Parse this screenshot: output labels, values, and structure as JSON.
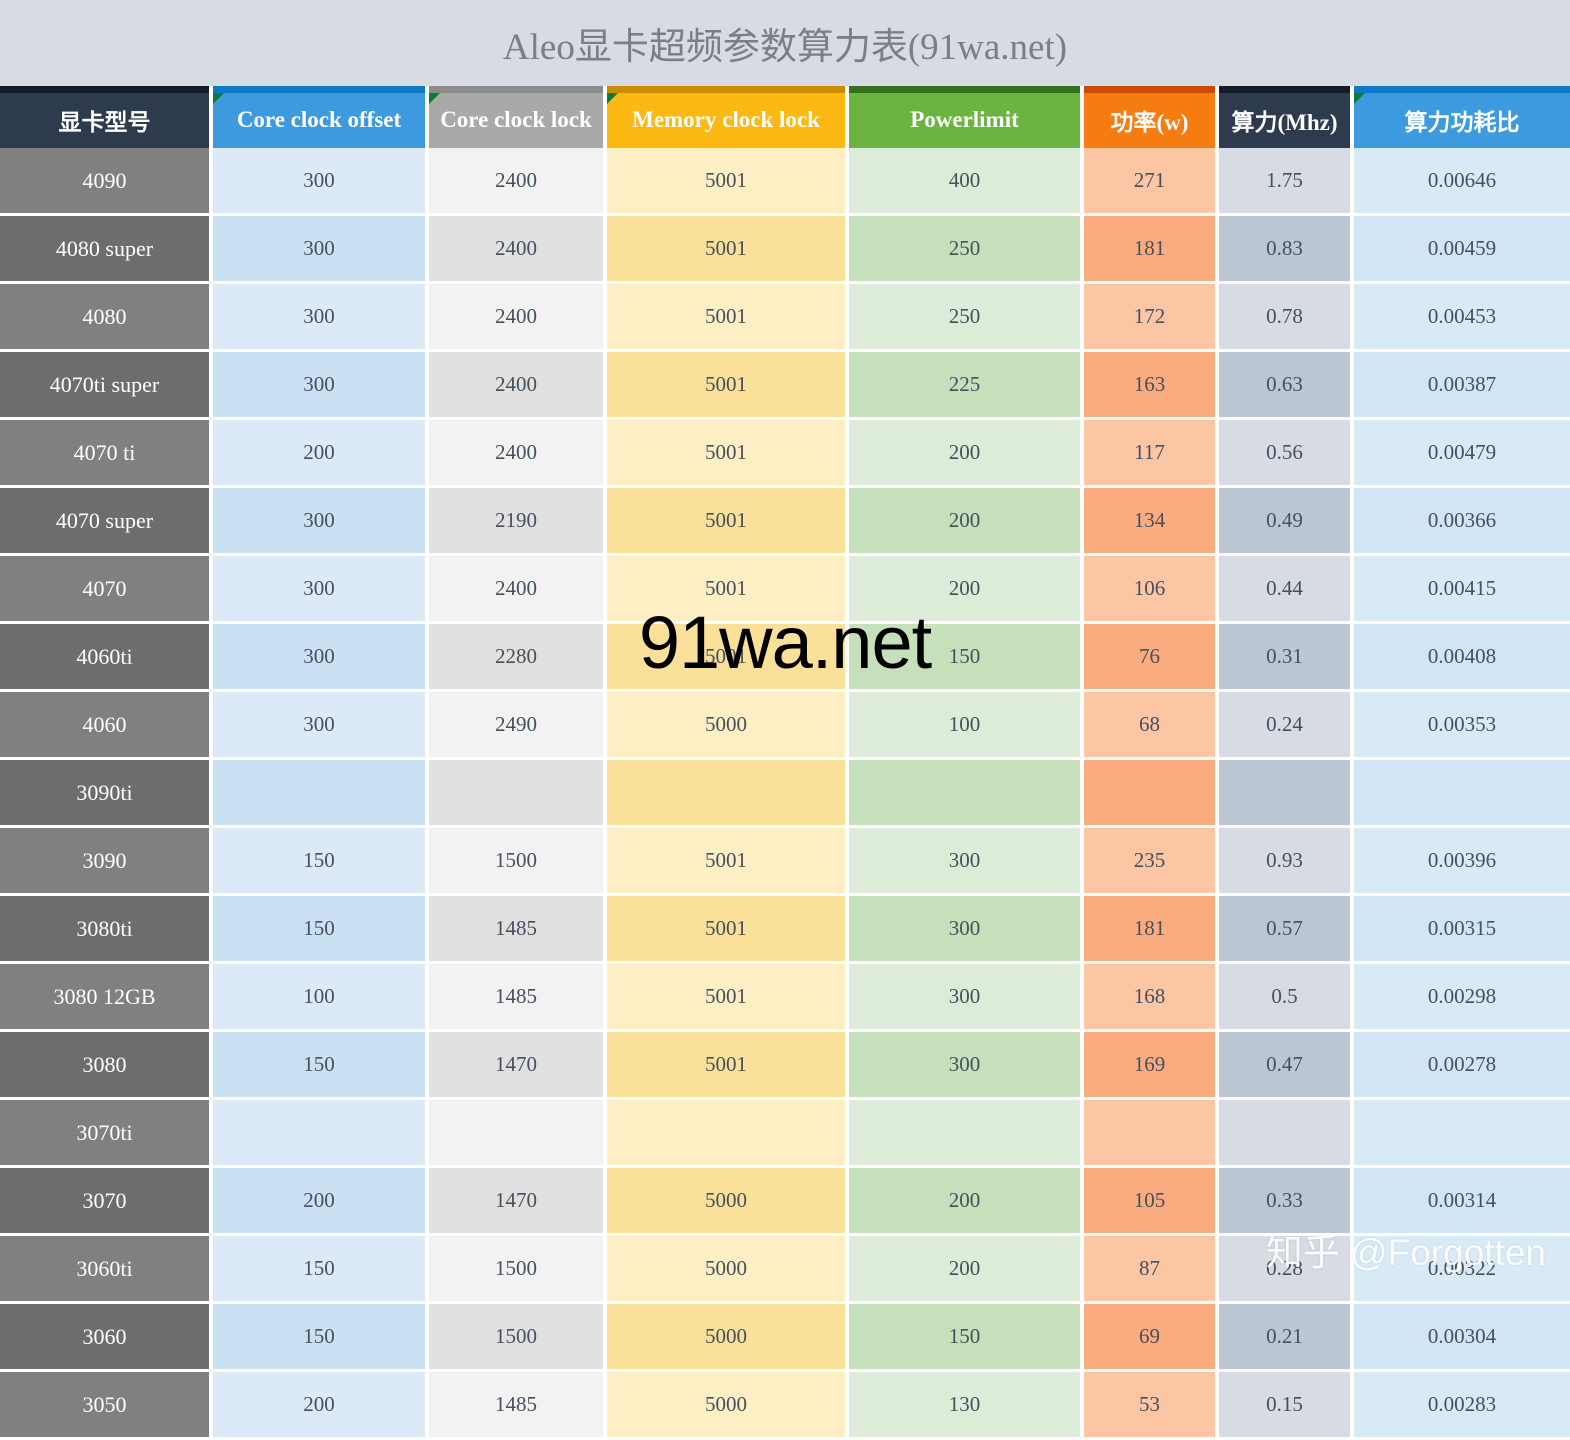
{
  "title": "Aleo显卡超频参数算力表(91wa.net)",
  "columns": [
    {
      "label": "显卡型号",
      "key": "model",
      "style": "h-dark",
      "triangle": false
    },
    {
      "label": "Core clock offset",
      "key": "coreoff",
      "style": "h-blue",
      "triangle": true
    },
    {
      "label": "Core clock lock",
      "key": "corelock",
      "style": "h-gray",
      "triangle": true
    },
    {
      "label": "Memory clock lock",
      "key": "memlock",
      "style": "h-amber",
      "triangle": true
    },
    {
      "label": "Powerlimit",
      "key": "power",
      "style": "h-green",
      "triangle": false
    },
    {
      "label": "功率(w)",
      "key": "watt",
      "style": "h-orange",
      "triangle": false
    },
    {
      "label": "算力(Mhz)",
      "key": "hash",
      "style": "h-dark",
      "triangle": false
    },
    {
      "label": "算力功耗比",
      "key": "ratio",
      "style": "h-blue",
      "triangle": true
    }
  ],
  "rows": [
    {
      "model": "4090",
      "coreoff": "300",
      "corelock": "2400",
      "memlock": "5001",
      "power": "400",
      "watt": "271",
      "hash": "1.75",
      "ratio": "0.00646"
    },
    {
      "model": "4080 super",
      "coreoff": "300",
      "corelock": "2400",
      "memlock": "5001",
      "power": "250",
      "watt": "181",
      "hash": "0.83",
      "ratio": "0.00459"
    },
    {
      "model": "4080",
      "coreoff": "300",
      "corelock": "2400",
      "memlock": "5001",
      "power": "250",
      "watt": "172",
      "hash": "0.78",
      "ratio": "0.00453"
    },
    {
      "model": "4070ti super",
      "coreoff": "300",
      "corelock": "2400",
      "memlock": "5001",
      "power": "225",
      "watt": "163",
      "hash": "0.63",
      "ratio": "0.00387"
    },
    {
      "model": "4070 ti",
      "coreoff": "200",
      "corelock": "2400",
      "memlock": "5001",
      "power": "200",
      "watt": "117",
      "hash": "0.56",
      "ratio": "0.00479"
    },
    {
      "model": "4070 super",
      "coreoff": "300",
      "corelock": "2190",
      "memlock": "5001",
      "power": "200",
      "watt": "134",
      "hash": "0.49",
      "ratio": "0.00366"
    },
    {
      "model": "4070",
      "coreoff": "300",
      "corelock": "2400",
      "memlock": "5001",
      "power": "200",
      "watt": "106",
      "hash": "0.44",
      "ratio": "0.00415"
    },
    {
      "model": "4060ti",
      "coreoff": "300",
      "corelock": "2280",
      "memlock": "5001",
      "power": "150",
      "watt": "76",
      "hash": "0.31",
      "ratio": "0.00408"
    },
    {
      "model": "4060",
      "coreoff": "300",
      "corelock": "2490",
      "memlock": "5000",
      "power": "100",
      "watt": "68",
      "hash": "0.24",
      "ratio": "0.00353"
    },
    {
      "model": "3090ti",
      "coreoff": "",
      "corelock": "",
      "memlock": "",
      "power": "",
      "watt": "",
      "hash": "",
      "ratio": ""
    },
    {
      "model": "3090",
      "coreoff": "150",
      "corelock": "1500",
      "memlock": "5001",
      "power": "300",
      "watt": "235",
      "hash": "0.93",
      "ratio": "0.00396"
    },
    {
      "model": "3080ti",
      "coreoff": "150",
      "corelock": "1485",
      "memlock": "5001",
      "power": "300",
      "watt": "181",
      "hash": "0.57",
      "ratio": "0.00315"
    },
    {
      "model": "3080 12GB",
      "coreoff": "100",
      "corelock": "1485",
      "memlock": "5001",
      "power": "300",
      "watt": "168",
      "hash": "0.5",
      "ratio": "0.00298"
    },
    {
      "model": "3080",
      "coreoff": "150",
      "corelock": "1470",
      "memlock": "5001",
      "power": "300",
      "watt": "169",
      "hash": "0.47",
      "ratio": "0.00278"
    },
    {
      "model": "3070ti",
      "coreoff": "",
      "corelock": "",
      "memlock": "",
      "power": "",
      "watt": "",
      "hash": "",
      "ratio": ""
    },
    {
      "model": "3070",
      "coreoff": "200",
      "corelock": "1470",
      "memlock": "5000",
      "power": "200",
      "watt": "105",
      "hash": "0.33",
      "ratio": "0.00314"
    },
    {
      "model": "3060ti",
      "coreoff": "150",
      "corelock": "1500",
      "memlock": "5000",
      "power": "200",
      "watt": "87",
      "hash": "0.28",
      "ratio": "0.00322"
    },
    {
      "model": "3060",
      "coreoff": "150",
      "corelock": "1500",
      "memlock": "5000",
      "power": "150",
      "watt": "69",
      "hash": "0.21",
      "ratio": "0.00304"
    },
    {
      "model": "3050",
      "coreoff": "200",
      "corelock": "1485",
      "memlock": "5000",
      "power": "130",
      "watt": "53",
      "hash": "0.15",
      "ratio": "0.00283"
    }
  ],
  "watermarks": {
    "main": "91wa.net",
    "tile": "91wa.net",
    "zhihu": "知乎 @Forgotten"
  },
  "colors": {
    "title_band": "#d6dbe4",
    "header_dark": "#2e3b4e",
    "header_blue": "#3d9ade",
    "header_gray": "#a9a9a9",
    "header_amber": "#fcb913",
    "header_green": "#6cb441",
    "header_orange": "#f57c11",
    "model_cell": "#808080"
  }
}
